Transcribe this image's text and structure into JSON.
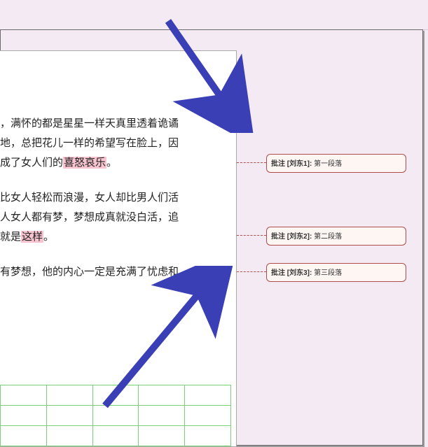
{
  "paragraphs": {
    "p1_l1": "，满怀的都是星星一样天真里透着诡谲",
    "p1_l2": "地，总把花儿一样的希望写在脸上，因",
    "p1_l3_a": "成了女人们的",
    "p1_l3_hl": "喜怒哀乐",
    "p1_l3_b": "。",
    "p2_l1": "比女人轻松而浪漫，女人却比男人们活",
    "p2_l2": "人女人都有梦，梦想成真就没白活，追",
    "p2_l3_a": "就是",
    "p2_l3_hl": "这样",
    "p2_l3_b": "。",
    "p3_l1": "有梦想，他的内心一定是充满了忧虑和"
  },
  "comments": [
    {
      "label": "批注 [刘东1]:",
      "text": "第一段落"
    },
    {
      "label": "批注 [刘东2]:",
      "text": "第二段落"
    },
    {
      "label": "批注 [刘东3]:",
      "text": "第三段落"
    }
  ],
  "arrows": {
    "color": "#3b3fb5"
  }
}
